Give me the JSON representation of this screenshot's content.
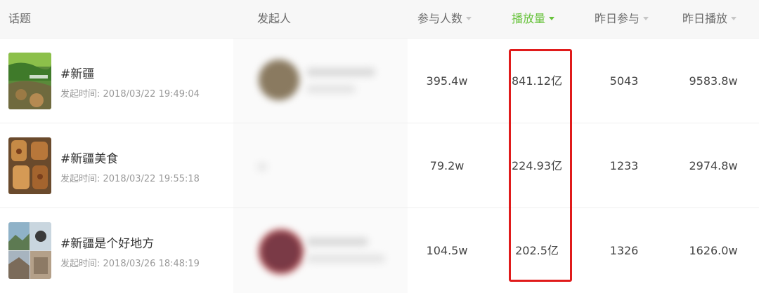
{
  "headers": {
    "topic": "话题",
    "creator": "发起人",
    "participants": "参与人数",
    "plays": "播放量",
    "yesterday_participants": "昨日参与",
    "yesterday_plays": "昨日播放"
  },
  "accent_color": "#66c23a",
  "highlight_color": "#e01b1b",
  "rows": [
    {
      "topic": "#新疆",
      "time": "发起时间:  2018/03/22 19:49:04",
      "participants": "395.4w",
      "plays": "841.12亿",
      "yesterday_participants": "5043",
      "yesterday_plays": "9583.8w"
    },
    {
      "topic": "#新疆美食",
      "time": "发起时间:  2018/03/22 19:55:18",
      "participants": "79.2w",
      "plays": "224.93亿",
      "yesterday_participants": "1233",
      "yesterday_plays": "2974.8w"
    },
    {
      "topic": "#新疆是个好地方",
      "time": "发起时间:  2018/03/26 18:48:19",
      "participants": "104.5w",
      "plays": "202.5亿",
      "yesterday_participants": "1326",
      "yesterday_plays": "1626.0w"
    }
  ]
}
